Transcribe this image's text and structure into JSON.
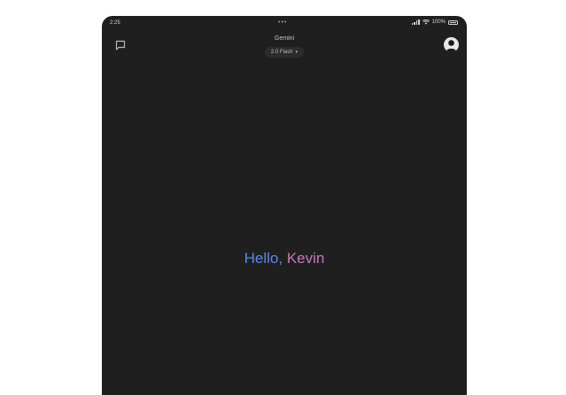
{
  "status_bar": {
    "time": "2:25",
    "dots": "•••",
    "battery": "100%"
  },
  "header": {
    "title": "Gemini",
    "model": "2.0 Flash",
    "model_caret": "▾"
  },
  "greeting": {
    "hello": "Hello,",
    "name": "Kevin"
  },
  "icons": {
    "left": "new-chat-icon",
    "right": "avatar"
  },
  "colors": {
    "background": "#1f1f20",
    "hello": "#5c86e6",
    "name": "#c47ab6"
  }
}
